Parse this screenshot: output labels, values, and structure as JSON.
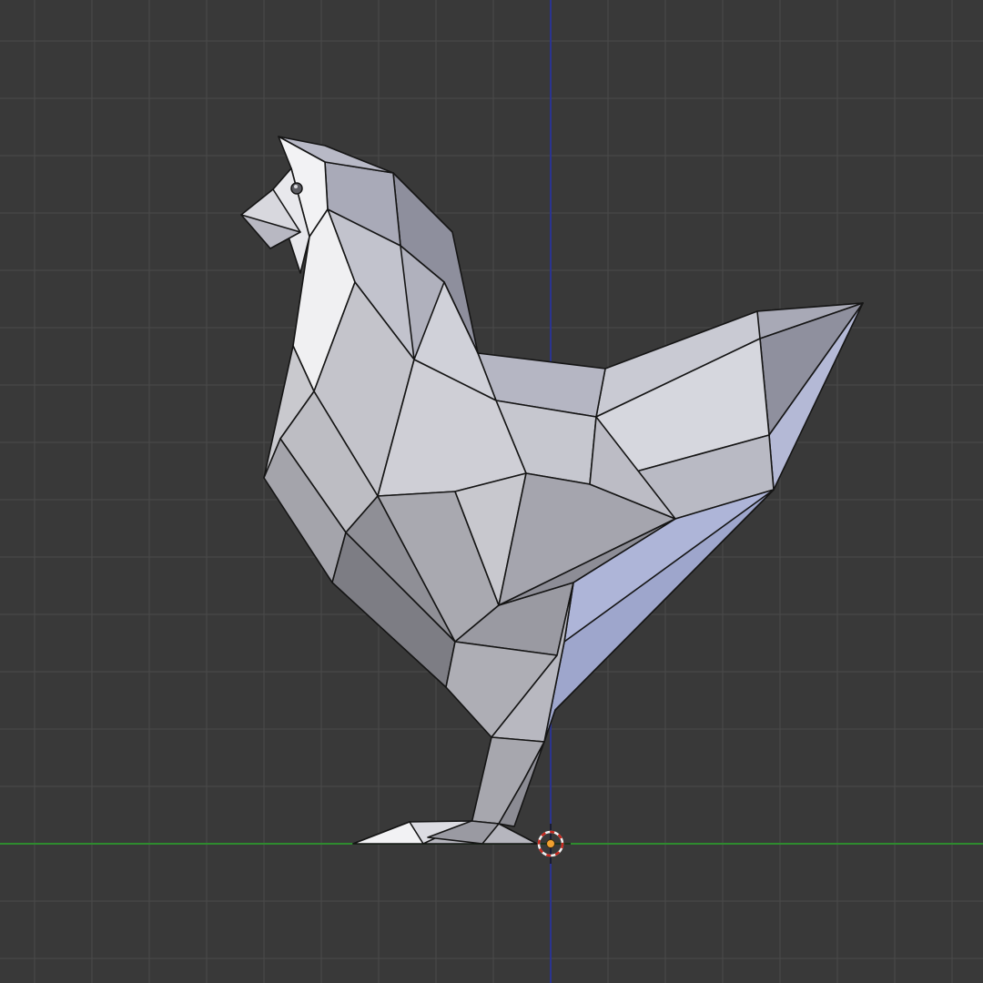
{
  "viewport": {
    "background": "#393939",
    "grid_color": "#4a4a4a",
    "x_axis_color": "#2e8b2e",
    "z_axis_color": "#2e3a9a",
    "mesh_edge_color": "#111111",
    "object": "chicken-low-poly-mesh",
    "cursor_colors": {
      "ring_red": "#c8281e",
      "ring_white": "#f0f0f0",
      "origin": "#f0a030"
    }
  }
}
